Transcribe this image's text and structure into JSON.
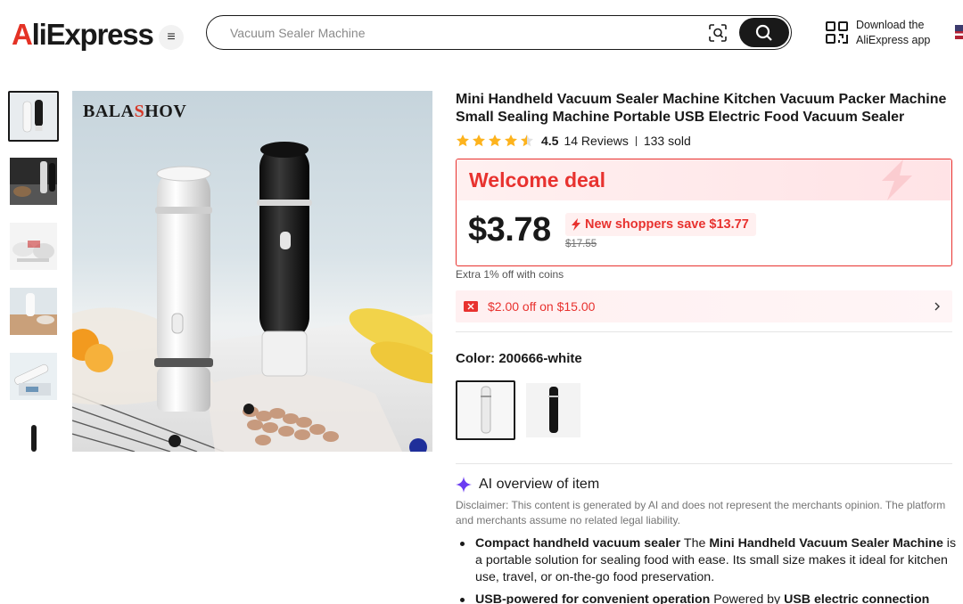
{
  "header": {
    "logo_prefix": "A",
    "logo_rest": "liExpress",
    "search_placeholder": "Vacuum Sealer Machine",
    "download_line1": "Download the",
    "download_line2": "AliExpress app",
    "menu_symbol": "≡"
  },
  "gallery": {
    "brand_prefix": "BALA",
    "brand_highlight": "S",
    "brand_suffix": "HOV",
    "thumbnail_count": 6,
    "active_thumbnail": 0
  },
  "product": {
    "title": "Mini Handheld Vacuum Sealer Machine Kitchen Vacuum Packer Machine Small Sealing Machine Portable USB Electric Food Vacuum Sealer",
    "rating": "4.5",
    "rating_stars": 4.5,
    "reviews": "14 Reviews",
    "sold": "133 sold"
  },
  "deal": {
    "title": "Welcome deal",
    "price": "$3.78",
    "save_text": "New shoppers save $13.77",
    "original_price": "$17.55",
    "coins_text": "Extra 1% off with coins",
    "coupon_text": "$2.00 off on $15.00"
  },
  "color": {
    "label": "Color: 200666-white",
    "options": [
      "white",
      "black"
    ],
    "selected": "white"
  },
  "ai": {
    "heading": "AI overview of item",
    "disclaimer": "Disclaimer: This content is generated by AI and does not represent the merchants opinion. The platform and merchants assume no related legal liability.",
    "bullet1_bold": "Compact handheld vacuum sealer",
    "bullet1_mid": " The ",
    "bullet1_bold2": "Mini Handheld Vacuum Sealer Machine",
    "bullet1_rest": " is a portable solution for sealing food with ease. Its small size makes it ideal for kitchen use, travel, or on-the-go food preservation.",
    "bullet2_bold": "USB-powered for convenient operation",
    "bullet2_mid": " Powered by ",
    "bullet2_bold2": "USB electric connection"
  },
  "colors": {
    "accent": "#e8322f",
    "text": "#191919",
    "star": "#fdb31d"
  }
}
